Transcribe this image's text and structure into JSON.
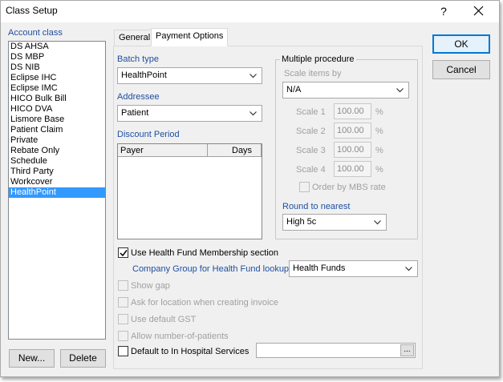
{
  "window": {
    "title": "Class Setup",
    "help_glyph": "?",
    "close_icon": "close-icon"
  },
  "account_class": {
    "label": "Account class",
    "items": [
      "DS AHSA",
      "DS MBP",
      "DS NIB",
      "Eclipse IHC",
      "Eclipse IMC",
      "HICO Bulk Bill",
      "HICO DVA",
      "Lismore Base",
      "Patient Claim",
      "Private",
      "Rebate Only",
      "Schedule",
      "Third Party",
      "Workcover",
      "HealthPoint"
    ],
    "selected": "HealthPoint"
  },
  "buttons": {
    "new_label": "New...",
    "delete_label": "Delete",
    "ok_label": "OK",
    "cancel_label": "Cancel"
  },
  "tabs": [
    "General",
    "Payment Options"
  ],
  "active_tab": "Payment Options",
  "payment": {
    "batch_type_label": "Batch type",
    "batch_type_value": "HealthPoint",
    "addressee_label": "Addressee",
    "addressee_value": "Patient",
    "discount_period_label": "Discount Period",
    "discount_columns": [
      "Payer",
      "Days"
    ],
    "multiple_procedure": {
      "title": "Multiple procedure",
      "scale_items_label": "Scale items by",
      "scale_items_value": "N/A",
      "scales": [
        {
          "label": "Scale 1",
          "value": "100.00",
          "unit": "%"
        },
        {
          "label": "Scale 2",
          "value": "100.00",
          "unit": "%"
        },
        {
          "label": "Scale 3",
          "value": "100.00",
          "unit": "%"
        },
        {
          "label": "Scale 4",
          "value": "100.00",
          "unit": "%"
        }
      ],
      "order_by_label": "Order by MBS rate",
      "round_label": "Round to nearest",
      "round_value": "High 5c"
    },
    "use_health_fund_label": "Use Health Fund Membership section",
    "company_group_label": "Company Group for Health Fund lookup",
    "company_group_value": "Health Funds",
    "show_gap_label": "Show gap",
    "ask_location_label": "Ask for location when creating invoice",
    "use_default_gst_label": "Use default GST",
    "allow_patients_label": "Allow number-of-patients",
    "default_hospital_label": "Default to In Hospital Services",
    "hospital_value": "",
    "ellipsis_label": "..."
  },
  "colors": {
    "selection": "#3399ff",
    "accent": "#0078d7",
    "label_blue": "#1f4fa0"
  }
}
